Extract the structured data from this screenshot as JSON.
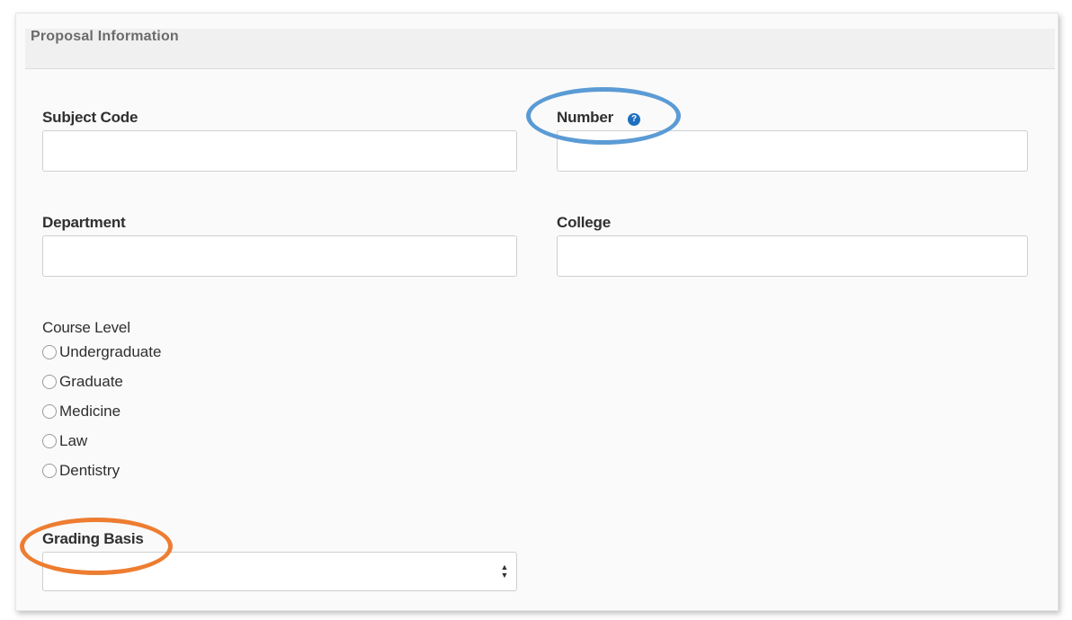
{
  "section": {
    "title": "Proposal Information"
  },
  "fields": {
    "subject_code": {
      "label": "Subject Code",
      "value": ""
    },
    "number": {
      "label": "Number",
      "value": "",
      "help_icon": "question-circle-icon"
    },
    "department": {
      "label": "Department",
      "value": ""
    },
    "college": {
      "label": "College",
      "value": ""
    }
  },
  "course_level": {
    "label": "Course Level",
    "options": [
      "Undergraduate",
      "Graduate",
      "Medicine",
      "Law",
      "Dentistry"
    ]
  },
  "grading_basis": {
    "label": "Grading Basis",
    "selected": ""
  },
  "highlights": {
    "number_color": "#5b9bd5",
    "grading_color": "#ed7d31"
  },
  "help_glyph": "?"
}
